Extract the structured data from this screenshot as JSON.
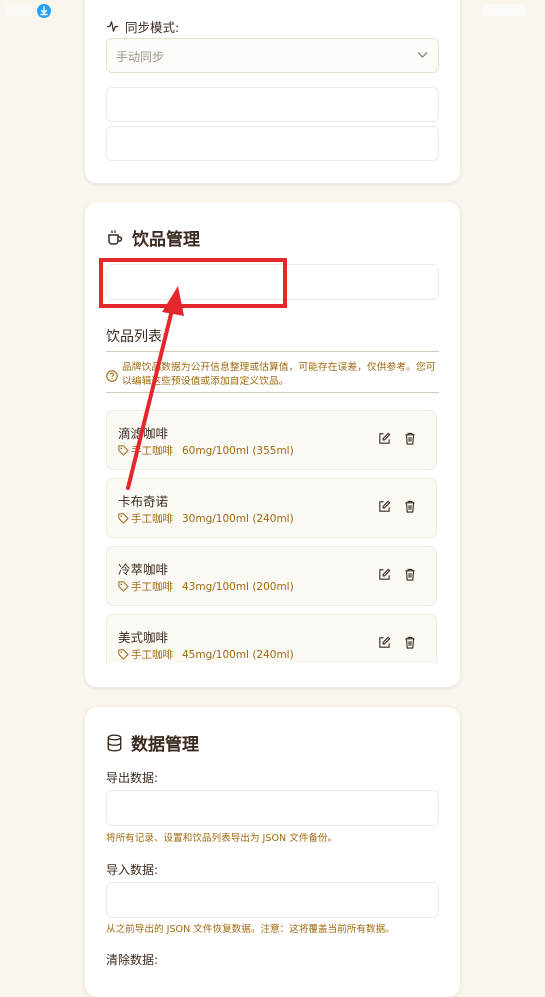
{
  "sync": {
    "label": "同步模式:",
    "select_value": "手动同步"
  },
  "drinks": {
    "title": "饮品管理",
    "list_label": "饮品列表:",
    "notice": "品牌饮品数据为公开信息整理或估算值，可能存在误差，仅供参考。您可以编辑这些预设值或添加自定义饮品。",
    "items": [
      {
        "name": "滴滤咖啡",
        "tag": "手工咖啡",
        "caffeine": "60mg/100ml (355ml)"
      },
      {
        "name": "卡布奇诺",
        "tag": "手工咖啡",
        "caffeine": "30mg/100ml (240ml)"
      },
      {
        "name": "冷萃咖啡",
        "tag": "手工咖啡",
        "caffeine": "43mg/100ml (200ml)"
      },
      {
        "name": "美式咖啡",
        "tag": "手工咖啡",
        "caffeine": "45mg/100ml (240ml)"
      }
    ]
  },
  "data_mgmt": {
    "title": "数据管理",
    "export_label": "导出数据:",
    "export_help": "将所有记录、设置和饮品列表导出为 JSON 文件备份。",
    "import_label": "导入数据:",
    "import_help": "从之前导出的 JSON 文件恢复数据。注意：这将覆盖当前所有数据。",
    "clear_label": "清除数据:"
  },
  "colors": {
    "accent": "#a06912",
    "highlight": "#e3272d",
    "text": "#3b2a1f",
    "background": "#faf6ee"
  }
}
